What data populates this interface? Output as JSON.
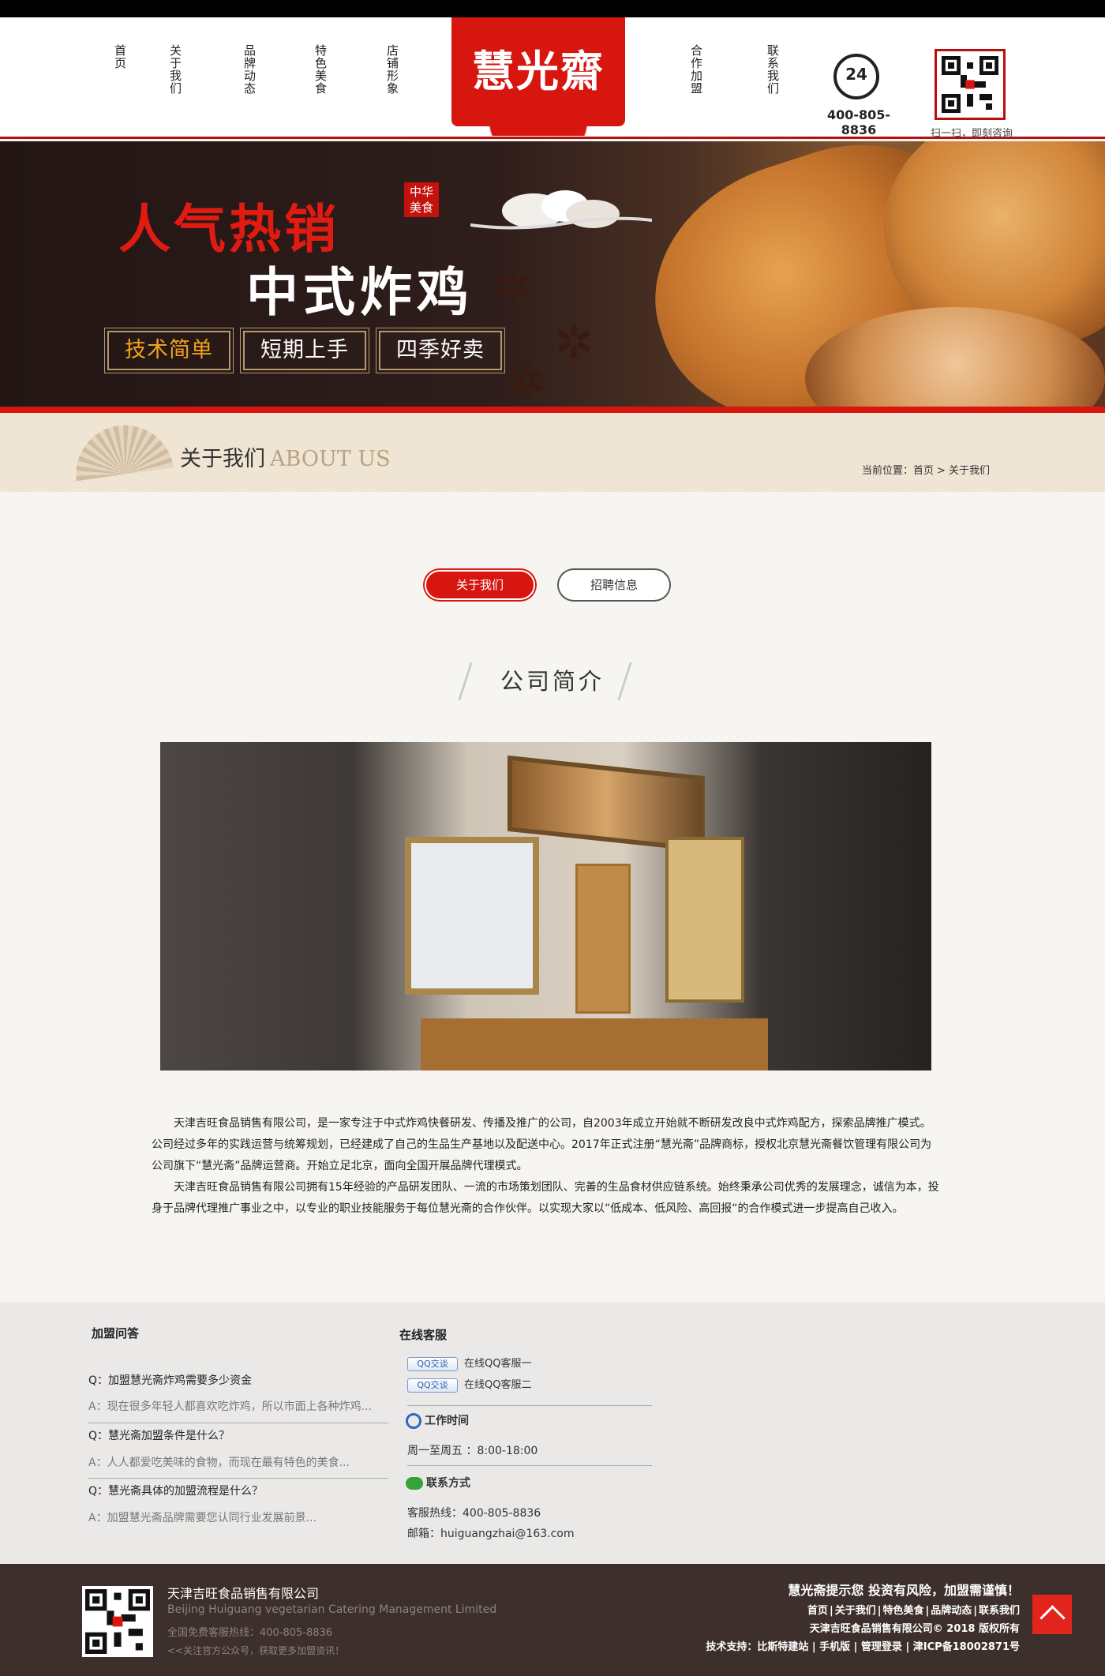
{
  "header": {
    "nav_left": [
      "首页",
      "关于我们",
      "品牌动态",
      "特色美食",
      "店铺形象"
    ],
    "nav_right": [
      "合作加盟",
      "联系我们"
    ],
    "logo_text": "慧光齋",
    "phone_badge": "24",
    "phone_number": "400-805-8836",
    "qr_caption": "扫一扫，即刻咨询"
  },
  "banner": {
    "title_red": "人气热销",
    "title_white": "中式炸鸡",
    "seal_top": "中华",
    "seal_bottom": "美食",
    "tags": [
      "技术简单",
      "短期上手",
      "四季好卖"
    ]
  },
  "about_bar": {
    "title": "关于我们",
    "title_en": "ABOUT US",
    "crumb_label": "当前位置：",
    "crumb_home": "首页",
    "crumb_sep": ">",
    "crumb_current": "关于我们"
  },
  "tabs": {
    "active": "关于我们",
    "inactive": "招聘信息"
  },
  "section": {
    "title": "公司简介"
  },
  "intro": {
    "p1": "天津吉旺食品销售有限公司，是一家专注于中式炸鸡快餐研发、传播及推广的公司，自2003年成立开始就不断研发改良中式炸鸡配方，探索品牌推广模式。公司经过多年的实践运营与统筹规划，已经建成了自己的生品生产基地以及配送中心。2017年正式注册“慧光斋”品牌商标，授权北京慧光斋餐饮管理有限公司为公司旗下“慧光斋”品牌运营商。开始立足北京，面向全国开展品牌代理模式。",
    "p2": "天津吉旺食品销售有限公司拥有15年经验的产品研发团队、一流的市场策划团队、完善的生品食材供应链系统。始终秉承公司优秀的发展理念，诚信为本，投身于品牌代理推广事业之中，以专业的职业技能服务于每位慧光斋的合作伙伴。以实现大家以“低成本、低风险、高回报“的合作模式进一步提高自己收入。"
  },
  "faq": {
    "title": "加盟问答",
    "items": [
      {
        "q": "Q：加盟慧光斋炸鸡需要多少资金",
        "a": "A：现在很多年轻人都喜欢吃炸鸡，所以市面上各种炸鸡..."
      },
      {
        "q": "Q：慧光斋加盟条件是什么？",
        "a": "A：人人都爱吃美味的食物，而现在最有特色的美食..."
      },
      {
        "q": "Q：慧光斋具体的加盟流程是什么？",
        "a": "A：加盟慧光斋品牌需要您认同行业发展前景..."
      }
    ]
  },
  "service": {
    "title": "在线客服",
    "qq_badge": "QQ交谈",
    "qq": [
      "在线QQ客服一",
      "在线QQ客服二"
    ],
    "work_title": "工作时间",
    "work_hours": "周一至周五 ：8:00-18:00",
    "contact_title": "联系方式",
    "hotline": "客服热线：400-805-8836",
    "email": "邮箱：huiguangzhai@163.com"
  },
  "footer": {
    "company": "天津吉旺食品销售有限公司",
    "company_en": "Beijing Huiguang vegetarian Catering Management Limited",
    "hotline": "全国免费客服热线：400-805-8836",
    "follow": "<<关注官方公众号，获取更多加盟资讯！",
    "warning": "慧光斋提示您 投资有风险，加盟需谨慎！",
    "links": [
      "首页",
      "关于我们",
      "特色美食",
      "品牌动态",
      "联系我们"
    ],
    "copyright": "天津吉旺食品销售有限公司© 2018  版权所有",
    "support": "技术支持：比斯特建站 | 手机版 | 管理登录 | 津ICP备18002871号"
  }
}
